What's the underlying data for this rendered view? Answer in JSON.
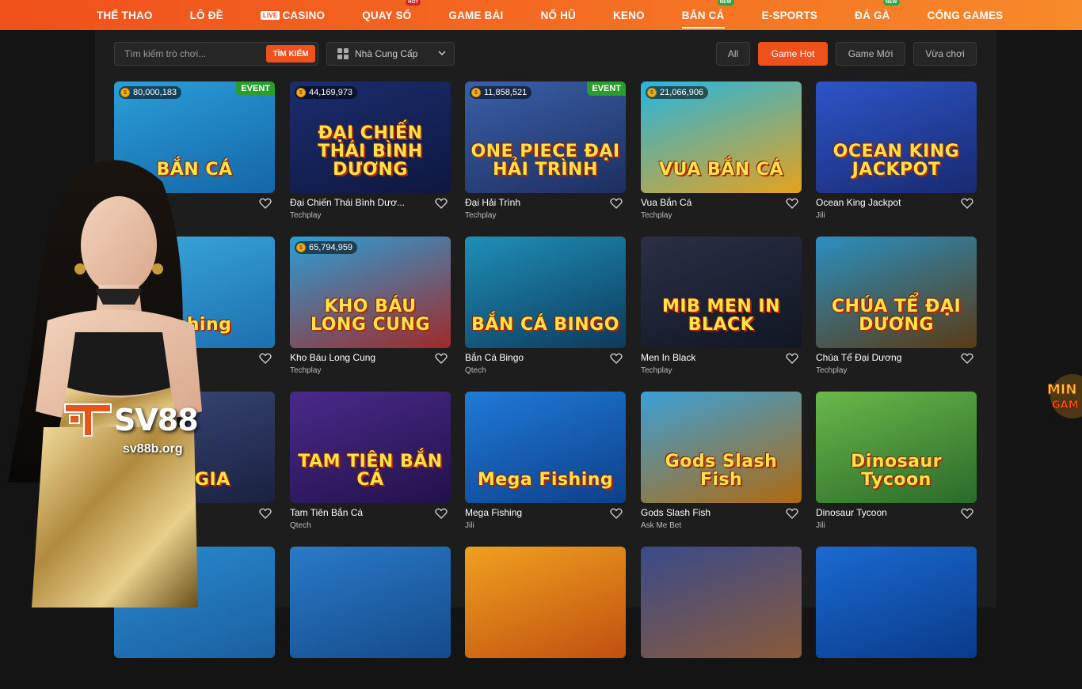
{
  "nav": [
    {
      "label": "THỂ THAO"
    },
    {
      "label": "LÔ ĐỀ"
    },
    {
      "label": "CASINO",
      "live": "LIVE"
    },
    {
      "label": "QUAY SỐ",
      "tag": "HOT"
    },
    {
      "label": "GAME BÀI"
    },
    {
      "label": "NỔ HŨ"
    },
    {
      "label": "KENO"
    },
    {
      "label": "BẮN CÁ",
      "tag": "NEW",
      "active": true
    },
    {
      "label": "E-SPORTS"
    },
    {
      "label": "ĐÁ GÀ",
      "tag": "NEW"
    },
    {
      "label": "CỔNG GAMES"
    }
  ],
  "search": {
    "placeholder": "Tìm kiếm trò chơi...",
    "button": "TÌM KIẾM"
  },
  "provider_select": {
    "label": "Nhà Cung Cấp"
  },
  "filters": {
    "all": "All",
    "hot": "Game Hot",
    "new": "Game Mới",
    "recent": "Vừa chơi"
  },
  "games": [
    {
      "name": "",
      "provider": "",
      "jackpot": "80,000,183",
      "event": "EVENT",
      "thumb_text": "BẮN CÁ",
      "bg": [
        "#2a9fd8",
        "#1565a8"
      ]
    },
    {
      "name": "Đại Chiến Thái Bình Dươ...",
      "provider": "Techplay",
      "jackpot": "44,169,973",
      "event": "",
      "thumb_text": "ĐẠI CHIẾN THÁI BÌNH DƯƠNG",
      "bg": [
        "#1c2d6e",
        "#0e1740"
      ]
    },
    {
      "name": "Đại Hải Trình",
      "provider": "Techplay",
      "jackpot": "11,858,521",
      "event": "EVENT",
      "thumb_text": "ONE PIECE ĐẠI HẢI TRÌNH",
      "bg": [
        "#3a5fa8",
        "#1d2f60"
      ]
    },
    {
      "name": "Vua Bắn Cá",
      "provider": "Techplay",
      "jackpot": "21,066,906",
      "event": "",
      "thumb_text": "VUA BẮN CÁ",
      "bg": [
        "#24b6e0",
        "#e6a21e"
      ]
    },
    {
      "name": "Ocean King Jackpot",
      "provider": "Jili",
      "jackpot": "",
      "event": "",
      "thumb_text": "OCEAN KING JACKPOT",
      "bg": [
        "#2d55c8",
        "#182a70"
      ]
    },
    {
      "name": "",
      "provider": "",
      "jackpot": "",
      "event": "",
      "thumb_text": "Fishing",
      "bg": [
        "#3aa8dc",
        "#1d6fb0"
      ]
    },
    {
      "name": "Kho Báu Long Cung",
      "provider": "Techplay",
      "jackpot": "65,794,959",
      "event": "",
      "thumb_text": "KHO BÁU LONG CUNG",
      "bg": [
        "#2b9ed8",
        "#a02a2a"
      ]
    },
    {
      "name": "Bắn Cá Bingo",
      "provider": "Qtech",
      "jackpot": "",
      "event": "",
      "thumb_text": "BẮN CÁ BINGO",
      "bg": [
        "#1f8fb8",
        "#0d3a5c"
      ]
    },
    {
      "name": "Men In Black",
      "provider": "Techplay",
      "jackpot": "",
      "event": "",
      "thumb_text": "MIB MEN IN BLACK",
      "bg": [
        "#2b2f45",
        "#101624"
      ]
    },
    {
      "name": "Chúa Tể Đại Dương",
      "provider": "Techplay",
      "jackpot": "",
      "event": "",
      "thumb_text": "CHÚA TỂ ĐẠI DƯƠNG",
      "bg": [
        "#2a8fc0",
        "#5a3b15"
      ]
    },
    {
      "name": "",
      "provider": "",
      "jackpot": "",
      "event": "",
      "thumb_text": "NG GIA",
      "bg": [
        "#3b4a7a",
        "#1a2040"
      ]
    },
    {
      "name": "Tam Tiên Bắn Cá",
      "provider": "Qtech",
      "jackpot": "",
      "event": "",
      "thumb_text": "TAM TIÊN BẮN CÁ",
      "bg": [
        "#4a2a8a",
        "#22114a"
      ]
    },
    {
      "name": "Mega Fishing",
      "provider": "Jili",
      "jackpot": "",
      "event": "",
      "thumb_text": "Mega Fishing",
      "bg": [
        "#1f7ad8",
        "#0e3f8a"
      ]
    },
    {
      "name": "Gods Slash Fish",
      "provider": "Ask Me Bet",
      "jackpot": "",
      "event": "",
      "thumb_text": "Gods Slash Fish",
      "bg": [
        "#3aa0d8",
        "#b06a10"
      ]
    },
    {
      "name": "Dinosaur Tycoon",
      "provider": "Jili",
      "jackpot": "",
      "event": "",
      "thumb_text": "Dinosaur Tycoon",
      "bg": [
        "#6ab84a",
        "#2a6a2a"
      ]
    },
    {
      "name": "",
      "provider": "",
      "jackpot": "",
      "event": "",
      "thumb_text": "",
      "bg": [
        "#2a8ad0",
        "#1a5fa0"
      ]
    },
    {
      "name": "",
      "provider": "",
      "jackpot": "",
      "event": "",
      "thumb_text": "",
      "bg": [
        "#2a7ac8",
        "#154a8a"
      ]
    },
    {
      "name": "",
      "provider": "",
      "jackpot": "",
      "event": "",
      "thumb_text": "",
      "bg": [
        "#f0a020",
        "#c05010"
      ]
    },
    {
      "name": "",
      "provider": "",
      "jackpot": "",
      "event": "",
      "thumb_text": "",
      "bg": [
        "#3a4a8a",
        "#8a5a3a"
      ]
    },
    {
      "name": "",
      "provider": "",
      "jackpot": "",
      "event": "",
      "thumb_text": "",
      "bg": [
        "#1a6ad0",
        "#0a3a8a"
      ]
    }
  ],
  "promo": {
    "brand": "SV88",
    "url": "sv88b.org",
    "mini_logo": "MINI GAME"
  },
  "colors": {
    "accent": "#f0501c",
    "event": "#2a9d2f",
    "panel": "#1d1d1d"
  }
}
